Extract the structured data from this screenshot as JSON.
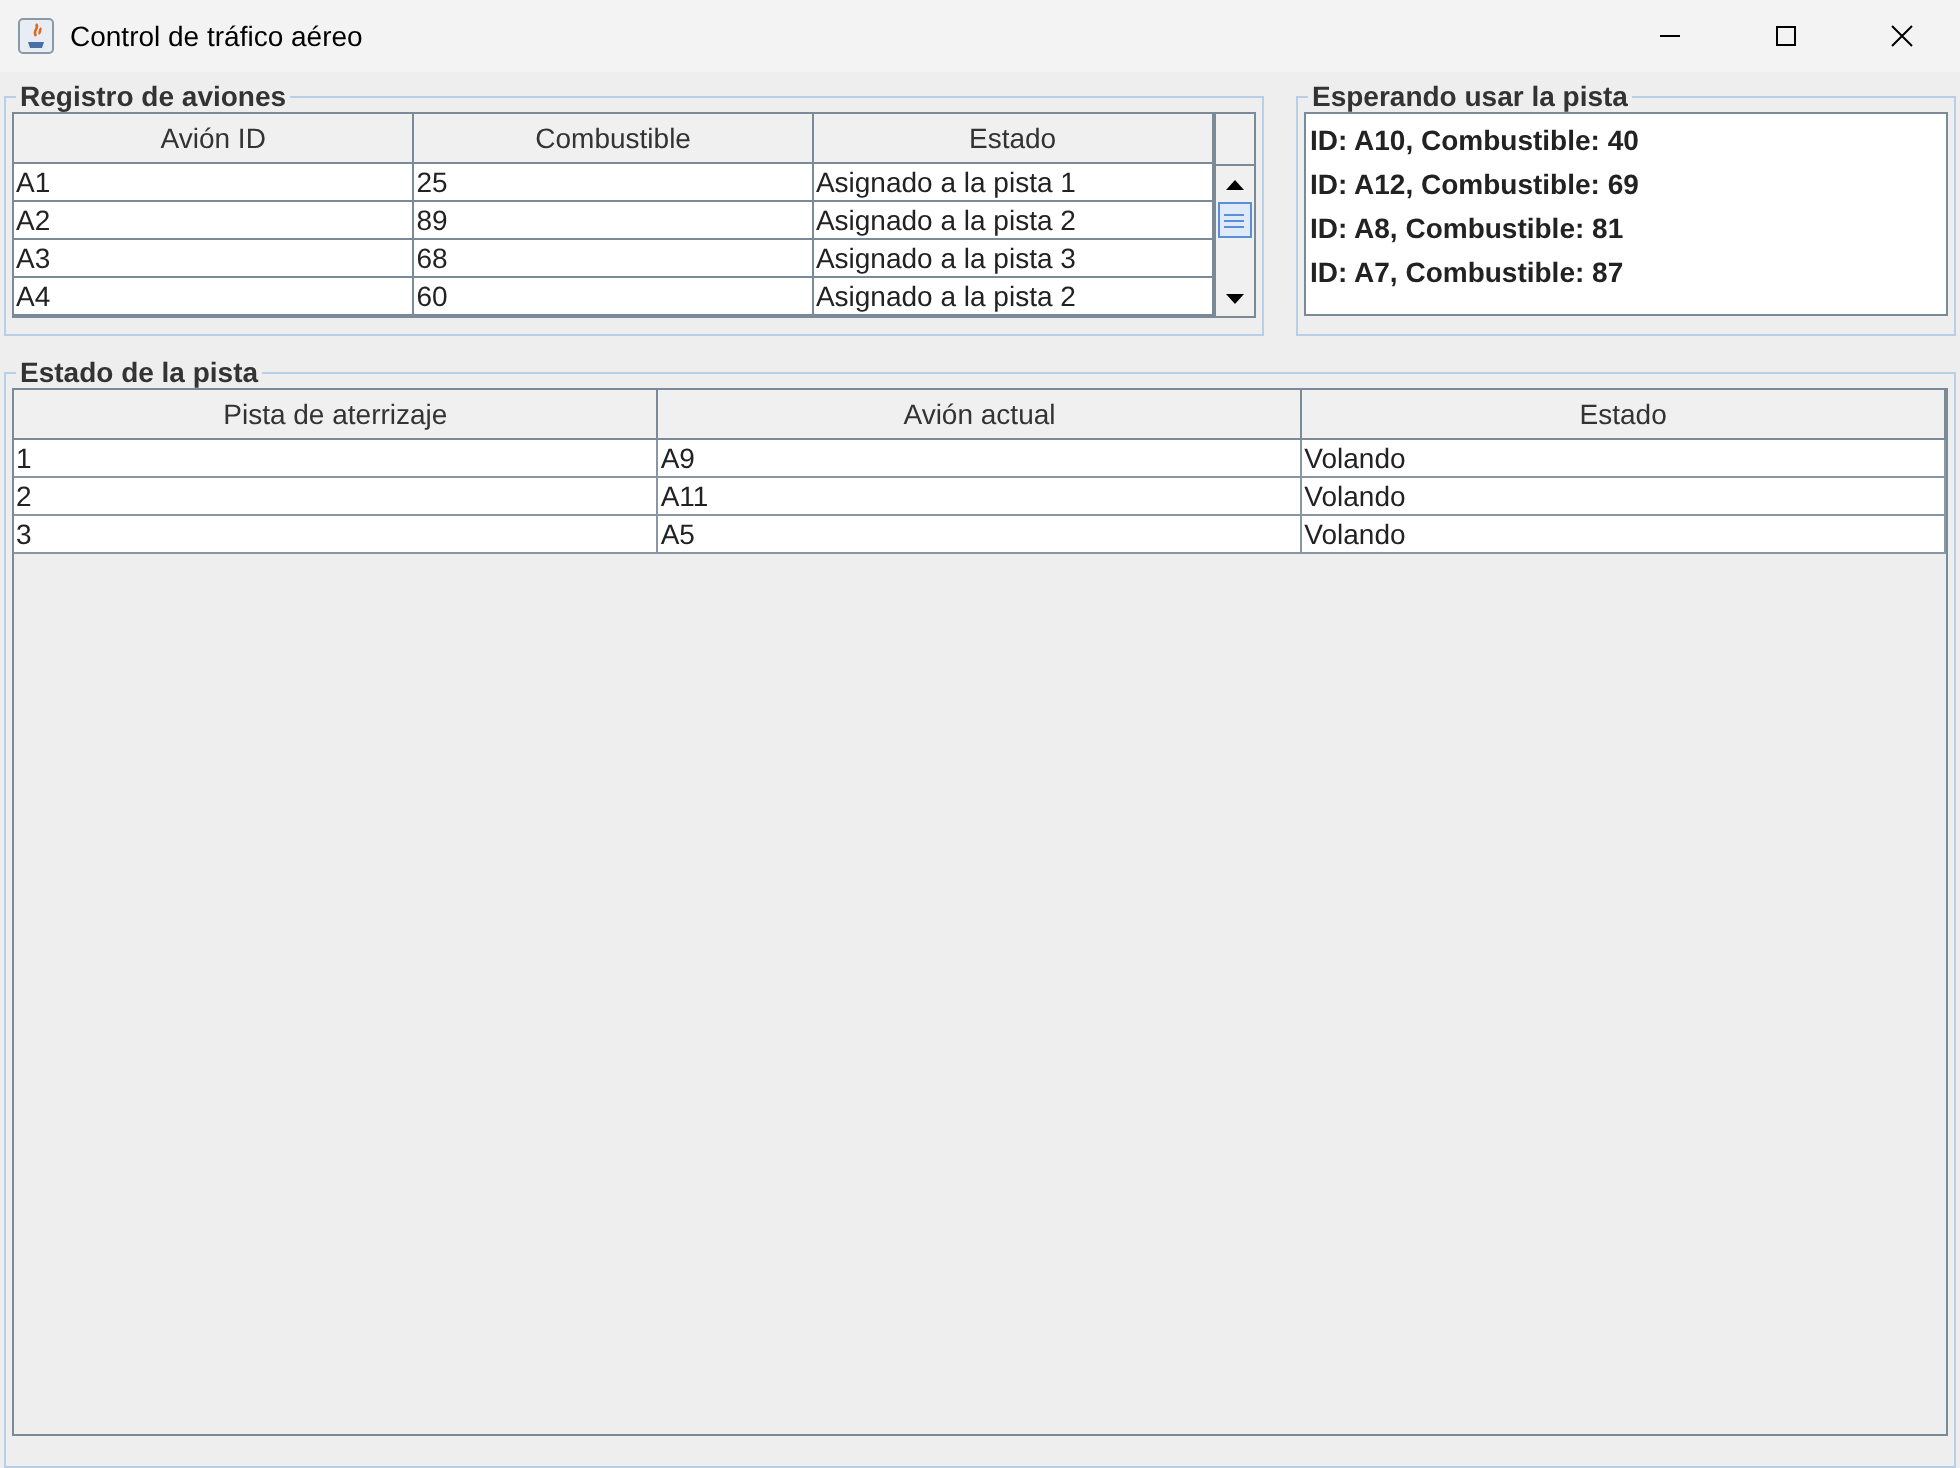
{
  "window": {
    "title": "Control de tráfico aéreo"
  },
  "registro": {
    "title": "Registro de aviones",
    "columns": [
      "Avión ID",
      "Combustible",
      "Estado"
    ],
    "rows": [
      [
        "A1",
        "25",
        "Asignado a la pista 1"
      ],
      [
        "A2",
        "89",
        "Asignado a la pista 2"
      ],
      [
        "A3",
        "68",
        "Asignado a la pista 3"
      ],
      [
        "A4",
        "60",
        "Asignado a la pista 2"
      ]
    ]
  },
  "espera": {
    "title": "Esperando usar la pista",
    "items": [
      "ID: A10, Combustible: 40",
      "ID: A12, Combustible: 69",
      "ID: A8, Combustible: 81",
      "ID: A7, Combustible: 87"
    ]
  },
  "pistas": {
    "title": "Estado de la pista",
    "columns": [
      "Pista de aterrizaje",
      "Avión actual",
      "Estado"
    ],
    "rows": [
      [
        "1",
        "A9",
        "Volando"
      ],
      [
        "2",
        "A11",
        "Volando"
      ],
      [
        "3",
        "A5",
        "Volando"
      ]
    ]
  }
}
